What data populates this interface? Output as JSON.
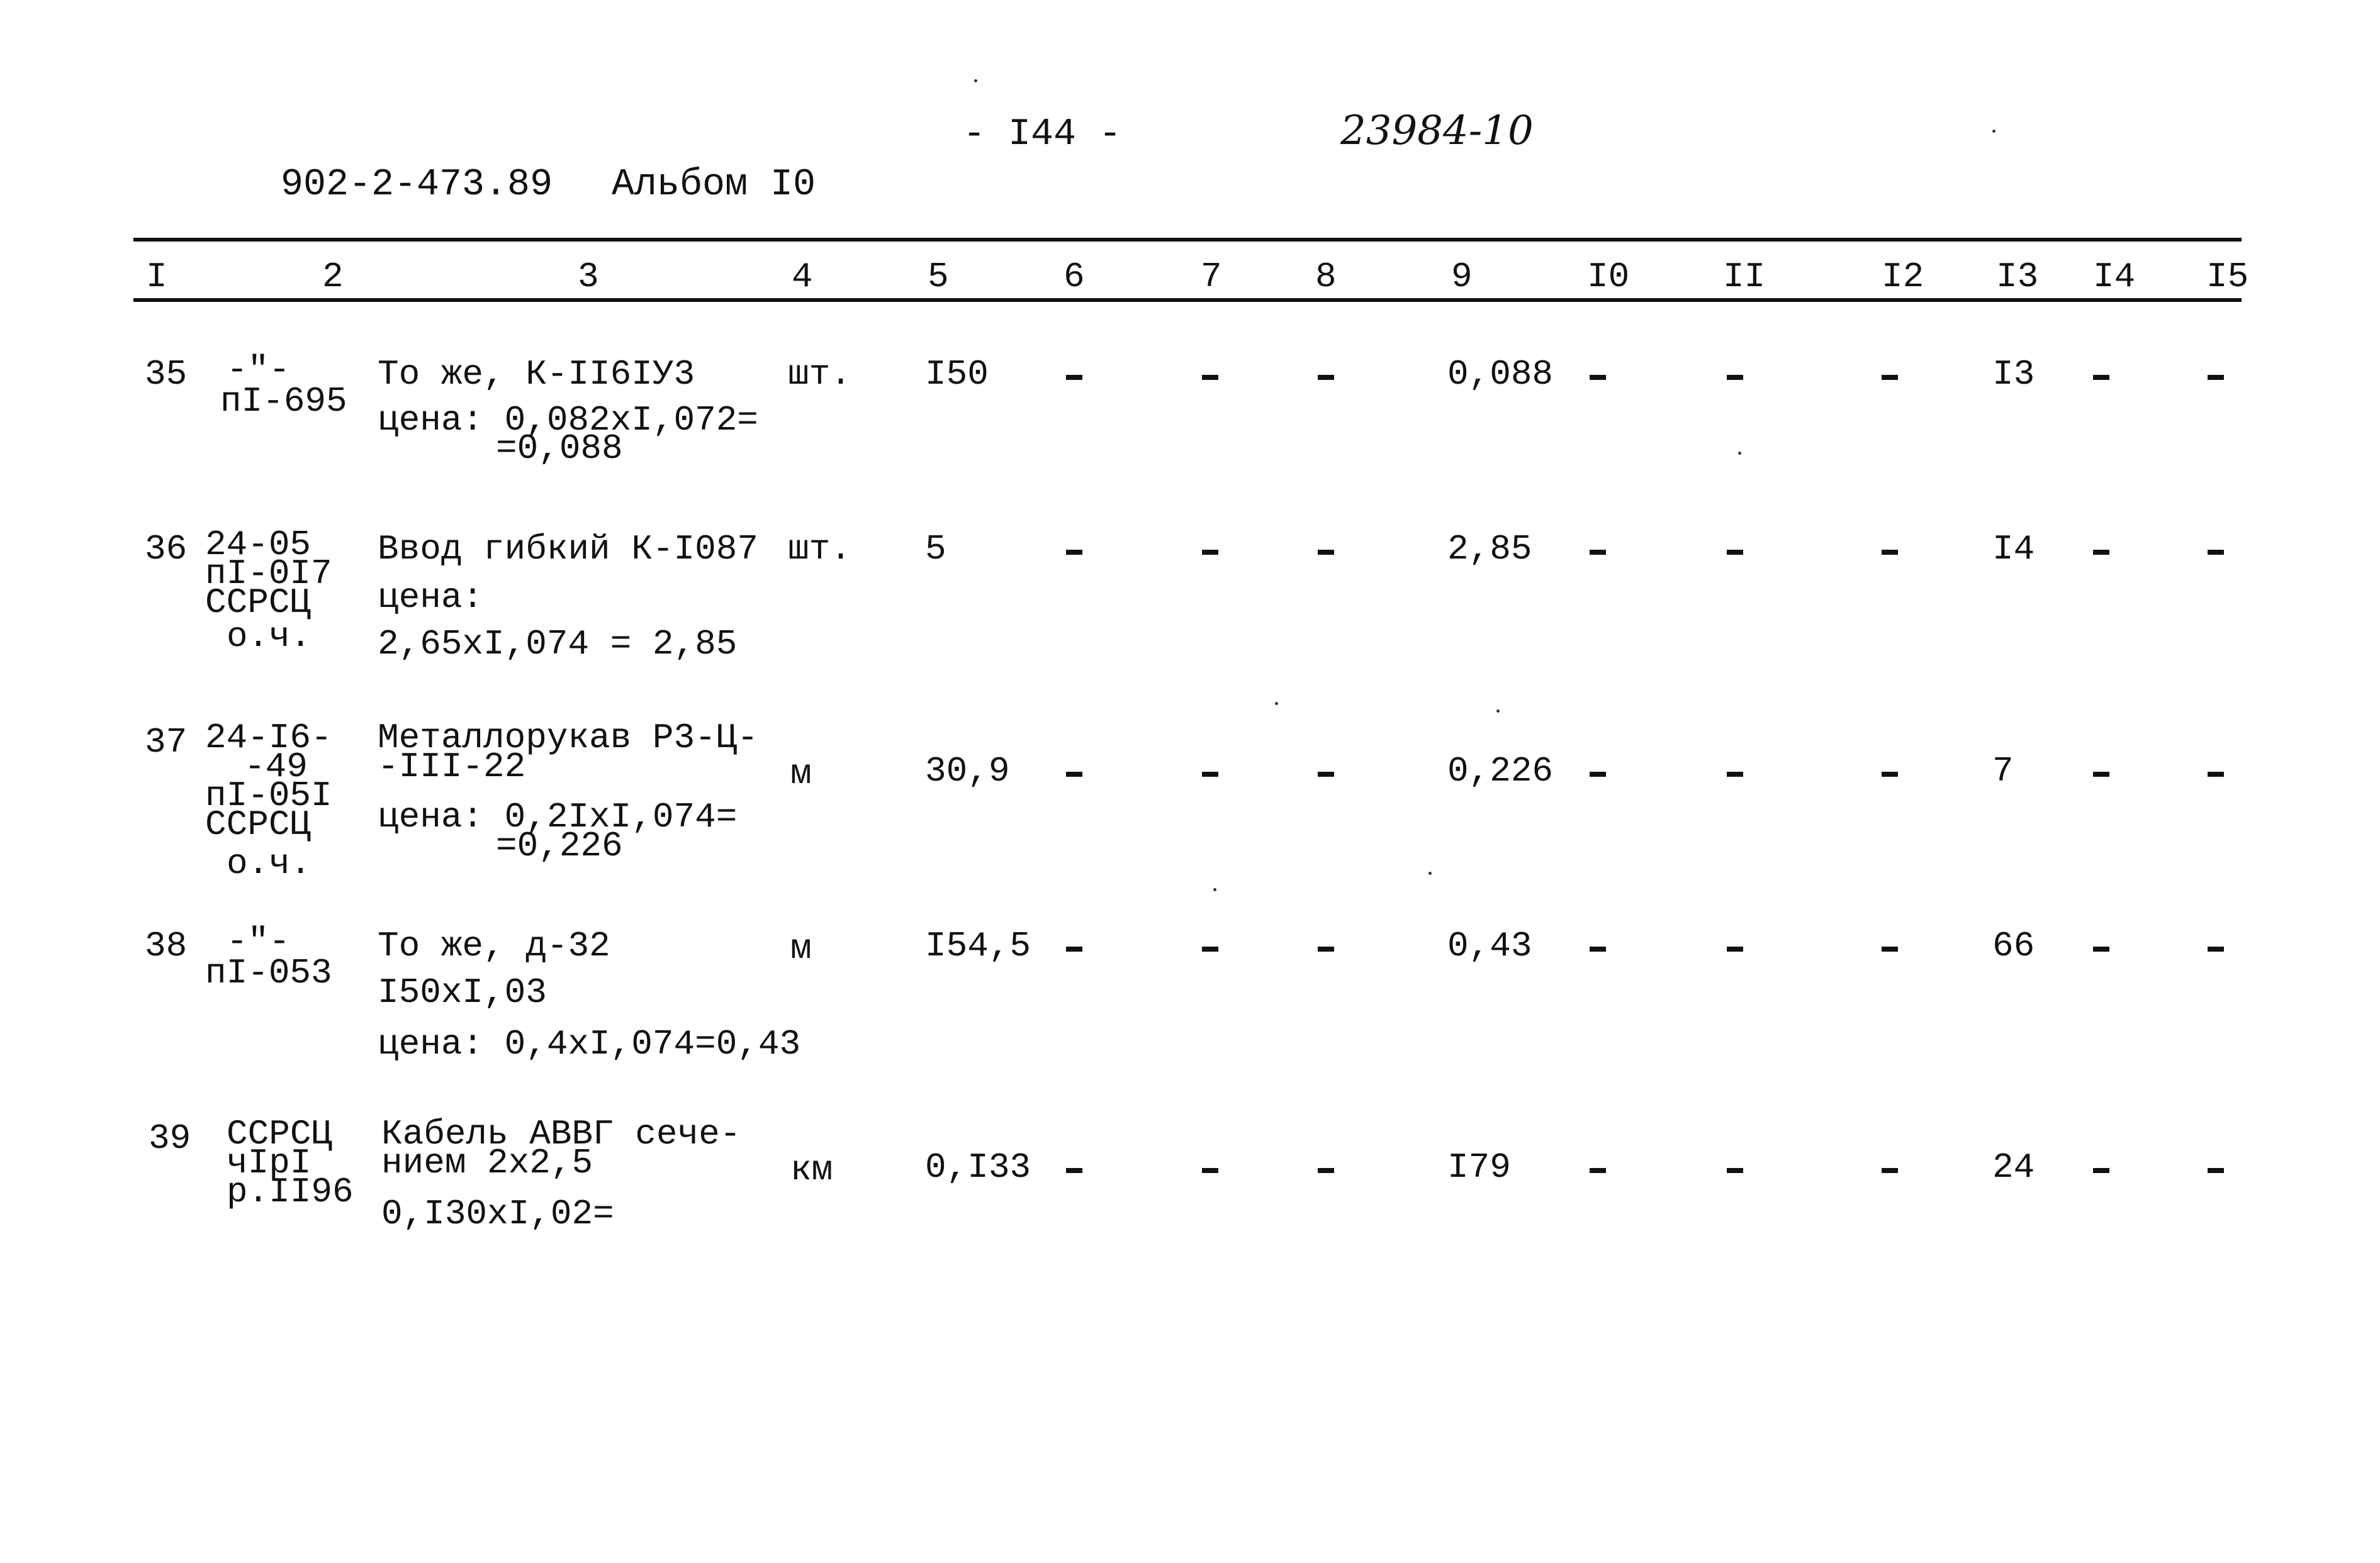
{
  "header": {
    "doc_code": "902-2-473.89",
    "album": "Альбом I0",
    "page_number": "- I44 -",
    "handwritten_number": "23984-10"
  },
  "table": {
    "columns": [
      "I",
      "2",
      "3",
      "4",
      "5",
      "6",
      "7",
      "8",
      "9",
      "I0",
      "II",
      "I2",
      "I3",
      "I4",
      "I5"
    ],
    "rows": [
      {
        "num": "35",
        "code": [
          "-\"-",
          "пI-695"
        ],
        "desc": [
          "То же, К-II6IУ3",
          "цена: 0,082хI,072=",
          "=0,088"
        ],
        "unit": "шт.",
        "qty": "I50",
        "c6": "-",
        "c7": "-",
        "c8": "-",
        "price": "0,088",
        "c10": "-",
        "c11": "-",
        "c12": "-",
        "c13": "I3",
        "c14": "-",
        "c15": "-"
      },
      {
        "num": "36",
        "code": [
          "24-05",
          "пI-0I7",
          "ССРСЦ",
          "о.ч."
        ],
        "desc": [
          "Ввод гибкий К-I087",
          "цена:",
          "2,65хI,074 = 2,85"
        ],
        "unit": "шт.",
        "qty": "5",
        "c6": "-",
        "c7": "-",
        "c8": "-",
        "price": "2,85",
        "c10": "-",
        "c11": "-",
        "c12": "-",
        "c13": "I4",
        "c14": "-",
        "c15": "-"
      },
      {
        "num": "37",
        "code": [
          "24-I6-",
          "-49",
          "пI-05I",
          "ССРСЦ",
          "о.ч."
        ],
        "desc": [
          "Металлорукав Р3-Ц-",
          "-III-22",
          "цена: 0,2IхI,074=",
          "=0,226"
        ],
        "unit": "м",
        "qty": "30,9",
        "c6": "-",
        "c7": "-",
        "c8": "-",
        "price": "0,226",
        "c10": "-",
        "c11": "-",
        "c12": "-",
        "c13": "7",
        "c14": "-",
        "c15": "-"
      },
      {
        "num": "38",
        "code": [
          "-\"-",
          "пI-053"
        ],
        "desc": [
          "То же, д-32",
          "I50хI,03",
          "цена: 0,4хI,074=0,43"
        ],
        "unit": "м",
        "qty": "I54,5",
        "c6": "-",
        "c7": "-",
        "c8": "-",
        "price": "0,43",
        "c10": "-",
        "c11": "-",
        "c12": "-",
        "c13": "66",
        "c14": "-",
        "c15": "-"
      },
      {
        "num": "39",
        "code": [
          "ССРСЦ",
          "чIрI",
          "р.II96"
        ],
        "desc": [
          "Кабель АВВГ сече-",
          "нием 2х2,5",
          "0,I30хI,02="
        ],
        "unit": "км",
        "qty": "0,I33",
        "c6": "-",
        "c7": "-",
        "c8": "-",
        "price": "I79",
        "c10": "-",
        "c11": "-",
        "c12": "-",
        "c13": "24",
        "c14": "-",
        "c15": "-"
      }
    ]
  }
}
